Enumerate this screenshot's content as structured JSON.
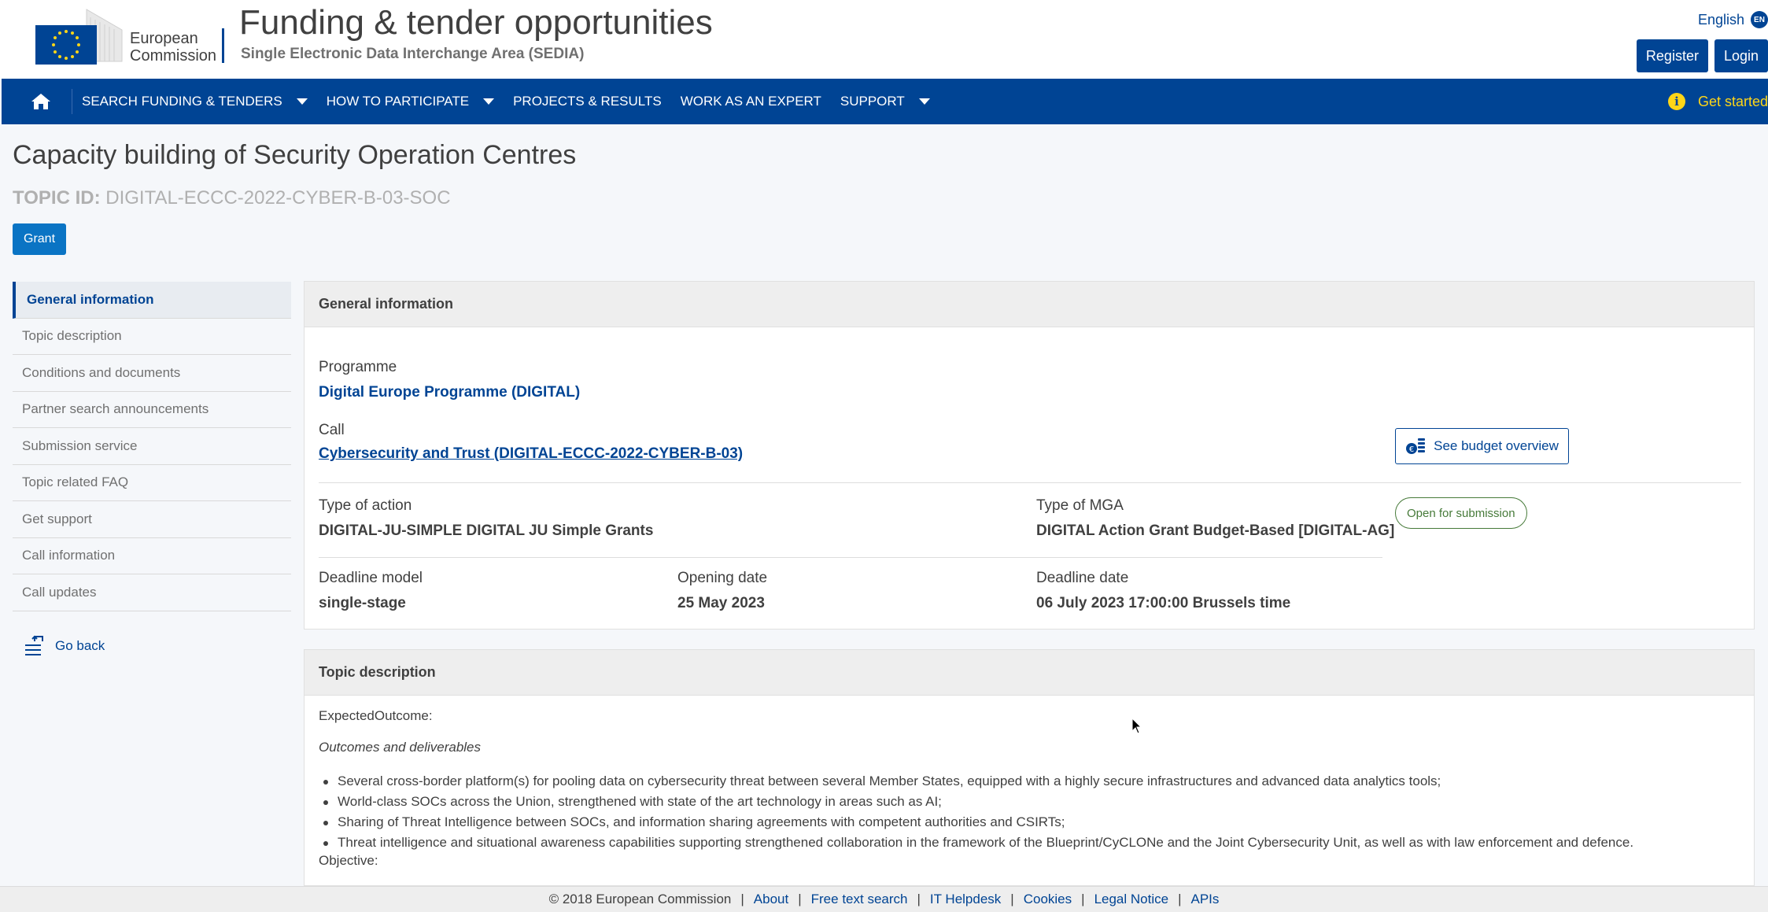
{
  "header": {
    "logo_line1": "European",
    "logo_line2": "Commission",
    "site_title": "Funding & tender opportunities",
    "site_subtitle": "Single Electronic Data Interchange Area (SEDIA)",
    "language": "English",
    "language_code": "EN",
    "register_label": "Register",
    "login_label": "Login"
  },
  "nav": {
    "items": [
      {
        "label": "SEARCH FUNDING & TENDERS",
        "dropdown": true
      },
      {
        "label": "HOW TO PARTICIPATE",
        "dropdown": true
      },
      {
        "label": "PROJECTS & RESULTS",
        "dropdown": false
      },
      {
        "label": "WORK AS AN EXPERT",
        "dropdown": false
      },
      {
        "label": "SUPPORT",
        "dropdown": true
      }
    ],
    "get_started": "Get started"
  },
  "page": {
    "title": "Capacity building of Security Operation Centres",
    "topic_id_label": "TOPIC ID:",
    "topic_id_value": "DIGITAL-ECCC-2022-CYBER-B-03-SOC",
    "grant_badge": "Grant"
  },
  "sidebar": {
    "items": [
      {
        "label": "General information",
        "active": true
      },
      {
        "label": "Topic description",
        "active": false
      },
      {
        "label": "Conditions and documents",
        "active": false
      },
      {
        "label": "Partner search announcements",
        "active": false
      },
      {
        "label": "Submission service",
        "active": false
      },
      {
        "label": "Topic related FAQ",
        "active": false
      },
      {
        "label": "Get support",
        "active": false
      },
      {
        "label": "Call information",
        "active": false
      },
      {
        "label": "Call updates",
        "active": false
      }
    ],
    "go_back": "Go back"
  },
  "general_info": {
    "header": "General information",
    "programme_label": "Programme",
    "programme_value": "Digital Europe Programme (DIGITAL)",
    "call_label": "Call",
    "call_value": "Cybersecurity and Trust (DIGITAL-ECCC-2022-CYBER-B-03)",
    "budget_button": "See budget overview",
    "type_of_action_label": "Type of action",
    "type_of_action_value": "DIGITAL-JU-SIMPLE DIGITAL JU Simple Grants",
    "type_of_mga_label": "Type of MGA",
    "type_of_mga_value": "DIGITAL Action Grant Budget-Based [DIGITAL-AG]",
    "status": "Open for submission",
    "deadline_model_label": "Deadline model",
    "deadline_model_value": "single-stage",
    "opening_date_label": "Opening date",
    "opening_date_value": "25 May 2023",
    "deadline_date_label": "Deadline date",
    "deadline_date_value": "06 July 2023 17:00:00 Brussels time"
  },
  "topic_description": {
    "header": "Topic description",
    "expected_outcome": "ExpectedOutcome:",
    "outcomes_heading": "Outcomes and deliverables",
    "bullets": [
      "Several cross-border platform(s) for pooling data on cybersecurity threat between several Member States, equipped with a highly secure infrastructures and advanced data analytics tools;",
      "World-class SOCs across the Union, strengthened with state of the art technology in areas such as AI;",
      "Sharing of Threat Intelligence between SOCs, and information sharing agreements with competent authorities and CSIRTs;",
      "Threat intelligence and situational awareness capabilities supporting strengthened collaboration in the framework of the Blueprint/CyCLONe and the Joint Cybersecurity Unit, as well as with law enforcement and defence."
    ],
    "objective": "Objective:"
  },
  "footer": {
    "copyright": "© 2018 European Commission",
    "links": [
      "About",
      "Free text search",
      "IT Helpdesk",
      "Cookies",
      "Legal Notice",
      "APIs"
    ]
  },
  "colors": {
    "brand_blue": "#004494",
    "accent_yellow": "#ffd617",
    "status_green": "#467a39"
  }
}
